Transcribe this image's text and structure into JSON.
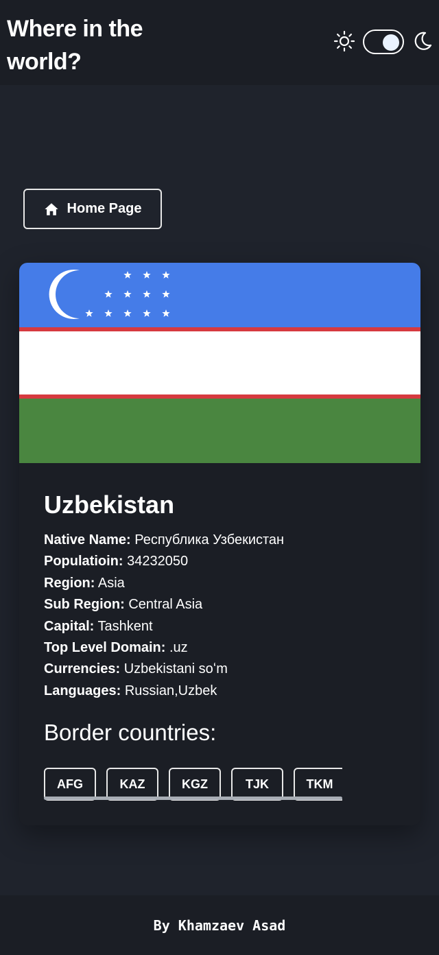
{
  "header": {
    "title": "Where in the world?",
    "theme": {
      "mode": "dark",
      "sun_icon": "sun-icon",
      "moon_icon": "moon-icon"
    }
  },
  "navigation": {
    "home_label": "Home Page",
    "home_icon": "home-icon"
  },
  "country": {
    "name": "Uzbekistan",
    "flag_alt": "Uzbekistan flag",
    "details": [
      {
        "label": "Native Name:",
        "value": "Республика Узбекистан"
      },
      {
        "label": "Populatioin:",
        "value": "34232050"
      },
      {
        "label": "Region:",
        "value": "Asia"
      },
      {
        "label": "Sub Region:",
        "value": "Central Asia"
      },
      {
        "label": "Capital:",
        "value": "Tashkent"
      },
      {
        "label": "Top Level Domain:",
        "value": ".uz"
      },
      {
        "label": "Currencies:",
        "value": "Uzbekistani soʻm"
      },
      {
        "label": "Languages:",
        "value": "Russian,Uzbek"
      }
    ],
    "border_title": "Border countries:",
    "borders": [
      "AFG",
      "KAZ",
      "KGZ",
      "TJK",
      "TKM"
    ]
  },
  "footer": {
    "text": "By Khamzaev Asad"
  },
  "colors": {
    "background": "#1f232c",
    "surface": "#1b1e25",
    "text": "#ffffff",
    "flag_blue": "#457ce8",
    "flag_red": "#d63a3f",
    "flag_white": "#ffffff",
    "flag_green": "#4a8640"
  }
}
